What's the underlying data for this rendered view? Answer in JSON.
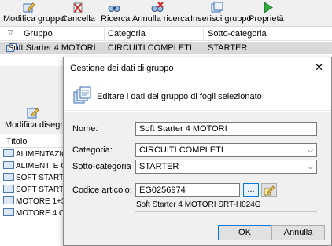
{
  "toolbar": {
    "buttons": [
      {
        "label": "Modifica gruppo",
        "icon": "edit-group-icon"
      },
      {
        "label": "Cancella",
        "icon": "delete-icon"
      },
      {
        "label": "Ricerca",
        "icon": "search-icon"
      },
      {
        "label": "Annulla ricerca",
        "icon": "cancel-search-icon"
      },
      {
        "label": "Inserisci gruppo",
        "icon": "insert-group-icon"
      },
      {
        "label": "Proprietà",
        "icon": "properties-icon"
      }
    ]
  },
  "grid": {
    "columns": [
      "Gruppo",
      "Categoria",
      "Sotto-categoria"
    ],
    "rows": [
      {
        "gruppo": "Soft Starter 4 MOTORI",
        "categoria": "CIRCUITI COMPLETI",
        "sottocategoria": "STARTER"
      }
    ]
  },
  "lower_panel": {
    "tool_label": "Modifica disegno",
    "list_header": "Titolo",
    "items": [
      "ALIMENTAZIO",
      "ALIMENT. E C",
      "SOFT STARTE",
      "SOFT STARTE",
      "MOTORE 1+3",
      "MOTORE 4 CI"
    ]
  },
  "dialog": {
    "title": "Gestione dei dati di gruppo",
    "banner_text": "Editare i dati del gruppo di fogli selezionato",
    "fields": {
      "nome_label": "Nome:",
      "nome_value": "Soft Starter 4 MOTORI",
      "categoria_label": "Categoria:",
      "categoria_value": "CIRCUITI COMPLETI",
      "sottocategoria_label": "Sotto-categoria",
      "sottocategoria_value": "STARTER",
      "codice_label": "Codice articolo:",
      "codice_value": "EG0256974"
    },
    "browse_label": "...",
    "description": "Soft Starter 4 MOTORI SRT-H024G",
    "ok_label": "OK",
    "cancel_label": "Annulla"
  },
  "colors": {
    "accent": "#0078d7",
    "selected_row": "#d9d9d9"
  }
}
